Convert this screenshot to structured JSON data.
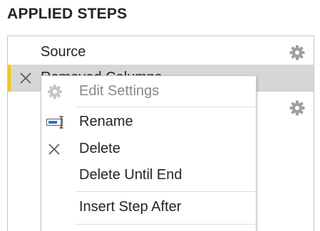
{
  "panel": {
    "title": "APPLIED STEPS"
  },
  "steps": [
    {
      "label": "Source",
      "icon": "gear-icon",
      "selected": false
    },
    {
      "label": "Removed Columns",
      "icon": "gear-icon",
      "selected": true,
      "delete_icon": "close-icon"
    },
    {
      "label": "",
      "icon": "gear-icon",
      "selected": false
    }
  ],
  "context_menu": {
    "items": [
      {
        "label": "Edit Settings",
        "icon": "gear-icon",
        "enabled": false
      },
      {
        "label": "Rename",
        "icon": "rename-icon",
        "enabled": true
      },
      {
        "label": "Delete",
        "icon": "close-icon",
        "enabled": true
      },
      {
        "label": "Delete Until End",
        "icon": "",
        "enabled": true
      },
      {
        "label": "Insert Step After",
        "icon": "",
        "enabled": true
      }
    ]
  },
  "colors": {
    "selection_accent": "#f2c811",
    "selected_row_bg": "#d6d6d6",
    "border": "#c8c6c4",
    "disabled_text": "#8a8886"
  }
}
